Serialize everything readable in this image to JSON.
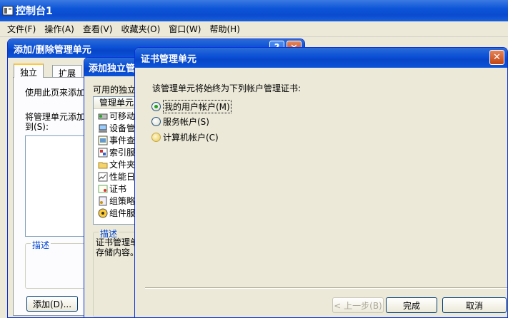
{
  "console": {
    "title": "控制台1",
    "menu": [
      "文件(F)",
      "操作(A)",
      "查看(V)",
      "收藏夹(O)",
      "窗口(W)",
      "帮助(H)"
    ]
  },
  "addremove": {
    "title": "添加/删除管理单元",
    "tabs": [
      "独立",
      "扩展"
    ],
    "intro": "使用此页来添加",
    "add_to_label": "将管理单元添加到(S):",
    "description_label": "描述",
    "add_button": "添加(D)..."
  },
  "standalone": {
    "title": "添加独立管",
    "available_label": "可用的独立",
    "column_header": "管理单元",
    "items": [
      {
        "label": "可移动",
        "icon": "removable-storage-icon"
      },
      {
        "label": "设备管",
        "icon": "device-manager-icon"
      },
      {
        "label": "事件查",
        "icon": "event-viewer-icon"
      },
      {
        "label": "索引服",
        "icon": "indexing-service-icon"
      },
      {
        "label": "文件夹",
        "icon": "folder-icon"
      },
      {
        "label": "性能日",
        "icon": "performance-logs-icon"
      },
      {
        "label": "证书",
        "icon": "certificates-icon"
      },
      {
        "label": "组策略",
        "icon": "group-policy-icon"
      },
      {
        "label": "组件服",
        "icon": "component-services-icon"
      }
    ],
    "description_label": "描述",
    "description_text": [
      "证书管理单",
      "存储内容。"
    ]
  },
  "cert": {
    "title": "证书管理单元",
    "prompt": "该管理单元将始终为下列帐户管理证书:",
    "options": [
      {
        "label": "我的用户帐户(M)",
        "checked": true
      },
      {
        "label": "服务帐户(S)",
        "checked": false
      },
      {
        "label": "计算机帐户(C)",
        "checked": false
      }
    ],
    "back_button": "< 上一步(B)",
    "finish_button": "完成",
    "cancel_button": "取消"
  }
}
